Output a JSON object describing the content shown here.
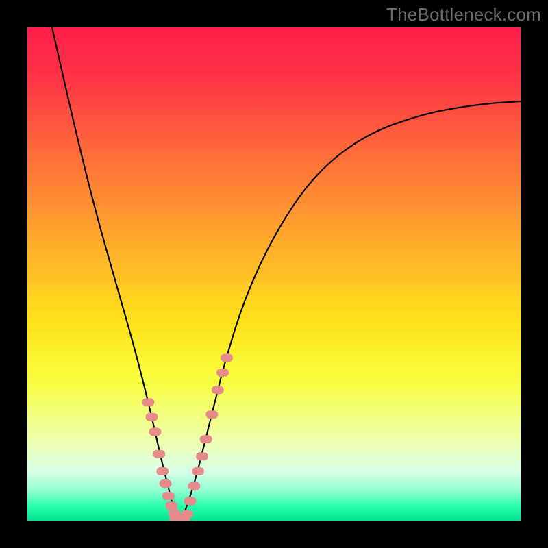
{
  "watermark": {
    "text": "TheBottleneck.com"
  },
  "chart_data": {
    "type": "line",
    "title": "",
    "xlabel": "",
    "ylabel": "",
    "xlim": [
      0,
      100
    ],
    "ylim": [
      0,
      100
    ],
    "grid": false,
    "legend": null,
    "background_gradient_stops": [
      {
        "offset": 0.0,
        "color": "#ff1f4a"
      },
      {
        "offset": 0.1,
        "color": "#ff3246"
      },
      {
        "offset": 0.25,
        "color": "#ff6a3a"
      },
      {
        "offset": 0.45,
        "color": "#ffb02a"
      },
      {
        "offset": 0.6,
        "color": "#ffe31a"
      },
      {
        "offset": 0.72,
        "color": "#f8ff40"
      },
      {
        "offset": 0.84,
        "color": "#edffb0"
      },
      {
        "offset": 0.9,
        "color": "#d8ffe7"
      },
      {
        "offset": 0.94,
        "color": "#8fffcf"
      },
      {
        "offset": 0.97,
        "color": "#2affac"
      },
      {
        "offset": 1.0,
        "color": "#00e38e"
      }
    ],
    "series": [
      {
        "name": "bottleneck-curve",
        "color": "#000000",
        "stroke_width": 2.2,
        "x": [
          5,
          10,
          14,
          18,
          22,
          25,
          27,
          28.5,
          29.5,
          30.2,
          30.8,
          31.3,
          32,
          34,
          36,
          38,
          40,
          44,
          50,
          58,
          68,
          80,
          92,
          100
        ],
        "y": [
          100,
          78,
          62,
          48,
          34,
          22,
          13,
          7,
          3,
          0.5,
          0,
          0.4,
          2,
          8,
          16,
          24,
          32,
          45,
          58,
          70,
          78,
          82.5,
          84.5,
          85
        ]
      },
      {
        "name": "highlight-left",
        "type": "scatter",
        "color": "#e58b8b",
        "marker": "pill",
        "x": [
          24.5,
          25.2,
          25.9,
          26.7,
          27.4,
          28.0,
          28.6,
          29.2,
          29.8
        ],
        "y": [
          24.0,
          21.0,
          18.0,
          13.5,
          10.0,
          7.5,
          5.0,
          3.0,
          1.5
        ]
      },
      {
        "name": "highlight-bottom",
        "type": "scatter",
        "color": "#e58b8b",
        "marker": "pill",
        "x": [
          30.0,
          30.6,
          31.2,
          31.8,
          32.4
        ],
        "y": [
          0.6,
          0.3,
          0.3,
          0.6,
          1.3
        ]
      },
      {
        "name": "highlight-right",
        "type": "scatter",
        "color": "#e58b8b",
        "marker": "pill",
        "x": [
          33.0,
          33.8,
          34.6,
          35.4,
          36.2,
          37.4,
          38.6,
          39.6,
          40.4
        ],
        "y": [
          4.0,
          7.0,
          10.0,
          13.0,
          16.5,
          21.5,
          26.5,
          30.0,
          33.0
        ]
      }
    ]
  }
}
